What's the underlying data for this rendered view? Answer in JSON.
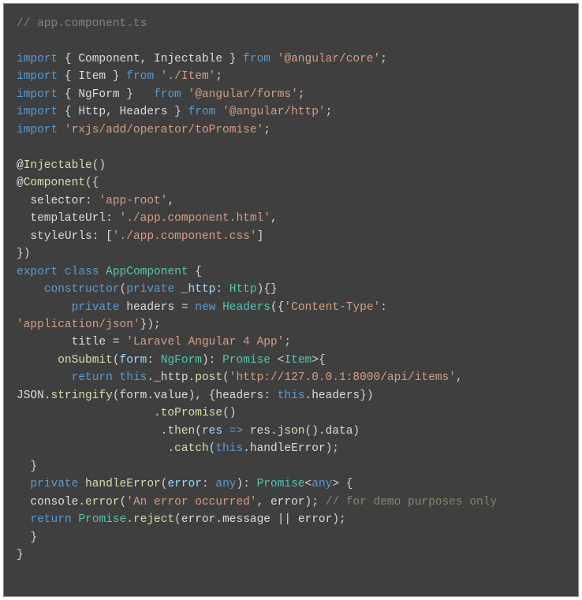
{
  "header_comment": "// app.component.ts",
  "lines": [
    {
      "kind": "blank"
    },
    {
      "kind": "import",
      "pre": "import ",
      "punct1": "{ ",
      "names": "Component, Injectable",
      "punct2": " } ",
      "from": "from ",
      "str": "'@angular/core'",
      "end": ";"
    },
    {
      "kind": "import",
      "pre": "import ",
      "punct1": "{ ",
      "names": "Item",
      "punct2": " } ",
      "from": "from ",
      "str": "'./Item'",
      "end": ";"
    },
    {
      "kind": "import",
      "pre": "import ",
      "punct1": "{ ",
      "names": "NgForm",
      "punct2": " }   ",
      "from": "from ",
      "str": "'@angular/forms'",
      "end": ";"
    },
    {
      "kind": "import",
      "pre": "import ",
      "punct1": "{ ",
      "names": "Http, Headers",
      "punct2": " } ",
      "from": "from ",
      "str": "'@angular/http'",
      "end": ";"
    },
    {
      "kind": "import_bare",
      "pre": "import ",
      "str": "'rxjs/add/operator/toPromise'",
      "end": ";"
    },
    {
      "kind": "blank"
    },
    {
      "kind": "decorator",
      "at": "@",
      "name": "Injectable",
      "args": "()"
    },
    {
      "kind": "decorator_open",
      "at": "@",
      "name": "Component",
      "args": "({"
    },
    {
      "kind": "prop",
      "indent": "  ",
      "key": "selector",
      "sep": ": ",
      "val": "'app-root'",
      "trail": ","
    },
    {
      "kind": "prop",
      "indent": "  ",
      "key": "templateUrl",
      "sep": ": ",
      "val": "'./app.component.html'",
      "trail": ","
    },
    {
      "kind": "prop_arr",
      "indent": "  ",
      "key": "styleUrls",
      "sep": ": [",
      "val": "'./app.component.css'",
      "trail": "]"
    },
    {
      "kind": "close",
      "text": "})"
    },
    {
      "kind": "export_class",
      "pre": "export ",
      "cls": "class ",
      "name": "AppComponent",
      "open": " {"
    },
    {
      "kind": "ctor",
      "indent": "    ",
      "kw": "constructor",
      "open": "(",
      "mod": "private ",
      "param": "_http",
      "colon": ": ",
      "type": "Http",
      "close": "){}"
    },
    {
      "kind": "headers",
      "indent": "        ",
      "mod": "private ",
      "var": "headers ",
      "eq": "= ",
      "new": "new ",
      "cls": "Headers",
      "open": "({",
      "key": "'Content-Type'",
      "colon": ":"
    },
    {
      "kind": "headers2",
      "str": "'application/json'",
      "close": "});"
    },
    {
      "kind": "title",
      "indent": "        ",
      "var": "title ",
      "eq": "= ",
      "str": "'Laravel Angular 4 App'",
      "end": ";"
    },
    {
      "kind": "onsubmit",
      "indent": "      ",
      "fn": "onSubmit",
      "open": "(",
      "param": "form",
      "colon": ": ",
      "type": "NgForm",
      "close": ")",
      "ret_colon": ": ",
      "ret": "Promise",
      "space": " ",
      "lt": "<",
      "gen": "Item",
      "gt": ">",
      "brace": "{"
    },
    {
      "kind": "return_post",
      "indent": "        ",
      "ret": "return ",
      "this": "this",
      "dot": ".",
      "member": "_http",
      "dot2": ".",
      "method": "post",
      "open": "(",
      "url": "'http://127.0.0.1:8000/api/items'",
      "comma": ","
    },
    {
      "kind": "json_stringify",
      "obj": "JSON",
      "dot": ".",
      "fn": "stringify",
      "open": "(",
      "arg": "form",
      "dot2": ".",
      "prop": "value",
      "close": ")",
      "comma": ", ",
      "obj2": "{",
      "key": "headers",
      "colon": ": ",
      "this": "this",
      "dot3": ".",
      "mem": "headers",
      "end": "})"
    },
    {
      "kind": "chain",
      "indent": "                    ",
      "dot": ".",
      "fn": "toPromise",
      "args": "()"
    },
    {
      "kind": "then",
      "indent": "                     ",
      "dot": ".",
      "fn": "then",
      "open": "(",
      "param": "res",
      "arrow": " => ",
      "body1": "res",
      "dot2": ".",
      "m1": "json",
      "paren": "()",
      "dot3": ".",
      "m2": "data",
      "close": ")"
    },
    {
      "kind": "catch",
      "indent": "                      ",
      "dot": ".",
      "fn": "catch",
      "open": "(",
      "this": "this",
      "dot2": ".",
      "mem": "handleError",
      "close": ");"
    },
    {
      "kind": "close",
      "text": "  }"
    },
    {
      "kind": "handle_err",
      "indent": "  ",
      "mod": "private ",
      "fn": "handleError",
      "open": "(",
      "param": "error",
      "colon": ": ",
      "type": "any",
      "close": ")",
      "ret_colon": ": ",
      "ret": "Promise",
      "lt": "<",
      "gen": "any",
      "gt": ">",
      "space": " ",
      "brace": "{"
    },
    {
      "kind": "console",
      "indent": "  ",
      "obj": "console",
      "dot": ".",
      "fn": "error",
      "open": "(",
      "str": "'An error occurred'",
      "comma": ", ",
      "arg": "error",
      "close": "); ",
      "comment": "// for demo purposes only"
    },
    {
      "kind": "ret_reject",
      "indent": "  ",
      "ret": "return ",
      "cls": "Promise",
      "dot": ".",
      "fn": "reject",
      "open": "(",
      "a": "error",
      "dot2": ".",
      "prop": "message",
      "bars": " || ",
      "b": "error",
      "close": ");"
    },
    {
      "kind": "close",
      "text": "  }"
    },
    {
      "kind": "close",
      "text": "}"
    }
  ]
}
